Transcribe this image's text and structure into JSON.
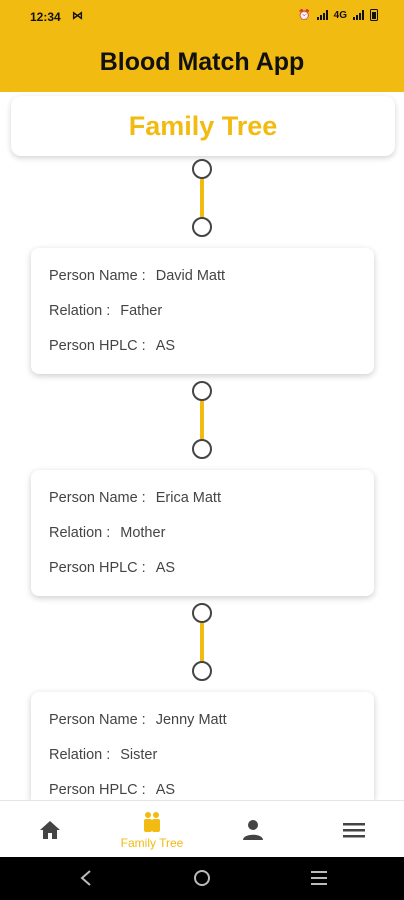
{
  "status_bar": {
    "time": "12:34",
    "notification_icon": "notification-icon",
    "network_1": "4G",
    "network_2": "4G"
  },
  "app_bar": {
    "title": "Blood Match App"
  },
  "header": {
    "title": "Family Tree"
  },
  "people": [
    {
      "name_label": "Person Name :",
      "name": "David Matt",
      "relation_label": "Relation :",
      "relation": "Father",
      "hplc_label": "Person HPLC :",
      "hplc": "AS"
    },
    {
      "name_label": "Person Name :",
      "name": "Erica Matt",
      "relation_label": "Relation :",
      "relation": "Mother",
      "hplc_label": "Person HPLC :",
      "hplc": "AS"
    },
    {
      "name_label": "Person Name :",
      "name": "Jenny Matt",
      "relation_label": "Relation :",
      "relation": "Sister",
      "hplc_label": "Person HPLC :",
      "hplc": "AS"
    }
  ],
  "bottom_nav": {
    "items": [
      {
        "icon": "home-icon",
        "label": ""
      },
      {
        "icon": "family-icon",
        "label": "Family Tree",
        "active": true
      },
      {
        "icon": "person-icon",
        "label": ""
      },
      {
        "icon": "menu-icon",
        "label": ""
      }
    ]
  },
  "colors": {
    "accent": "#F2BB12",
    "text": "#444444"
  }
}
